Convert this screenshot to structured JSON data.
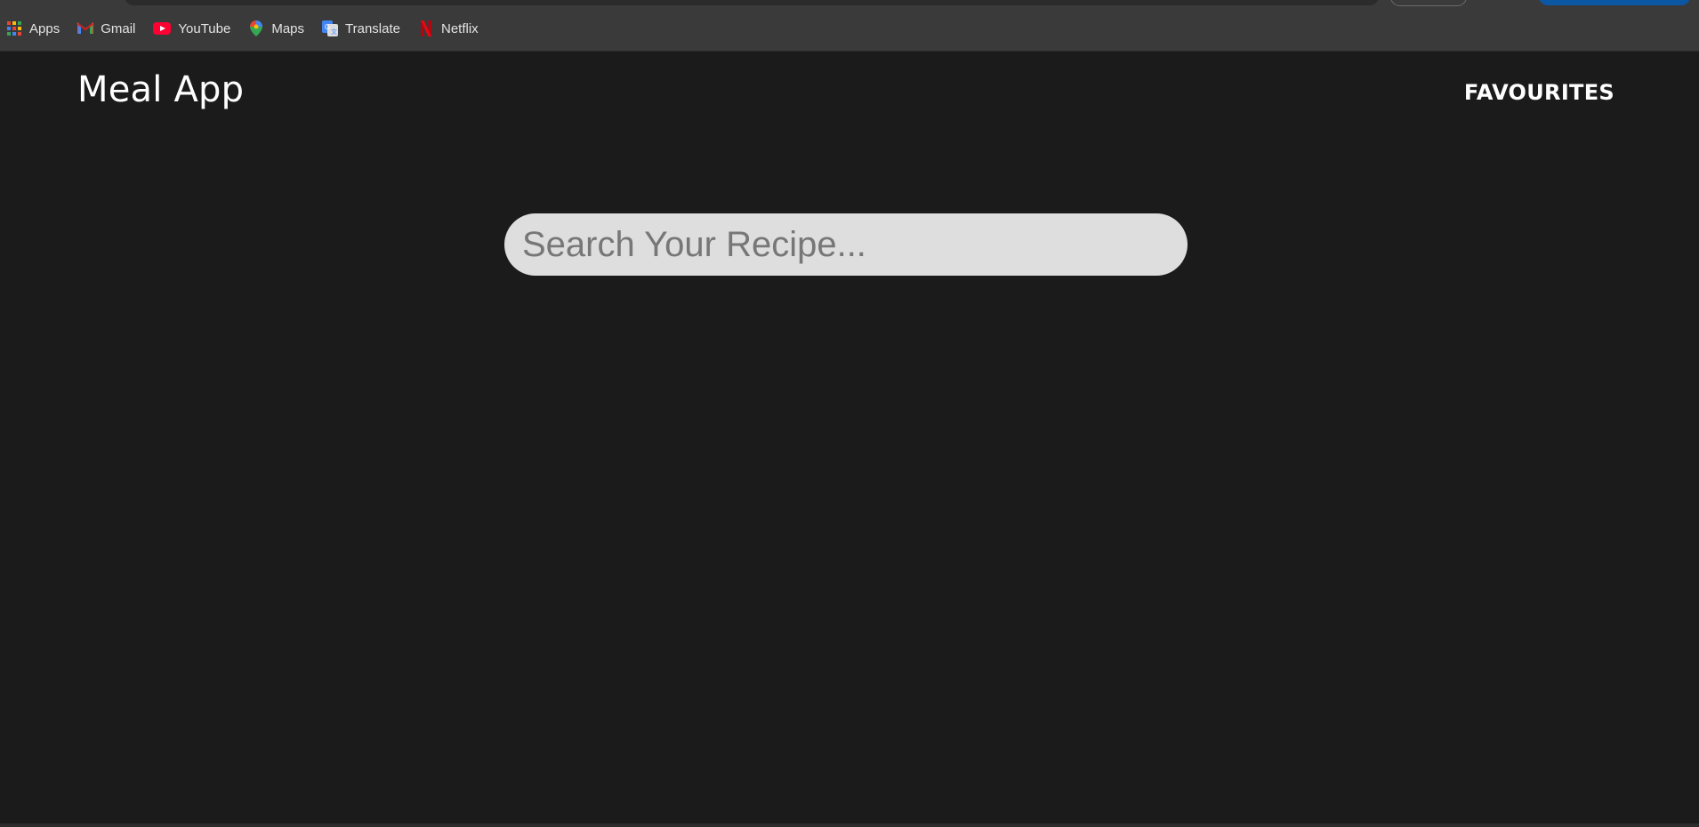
{
  "bookmarks": [
    {
      "label": "Apps",
      "icon": "apps-grid-icon"
    },
    {
      "label": "Gmail",
      "icon": "gmail-icon"
    },
    {
      "label": "YouTube",
      "icon": "youtube-icon"
    },
    {
      "label": "Maps",
      "icon": "maps-pin-icon"
    },
    {
      "label": "Translate",
      "icon": "translate-icon"
    },
    {
      "label": "Netflix",
      "icon": "netflix-icon"
    }
  ],
  "header": {
    "title": "Meal App",
    "nav_favourites": "FAVOURITES"
  },
  "search": {
    "placeholder": "Search Your Recipe...",
    "value": ""
  },
  "colors": {
    "page_background": "#1b1b1b",
    "bookmarks_bar": "#3a3a3a",
    "search_background": "#dedede",
    "text": "#ffffff"
  }
}
